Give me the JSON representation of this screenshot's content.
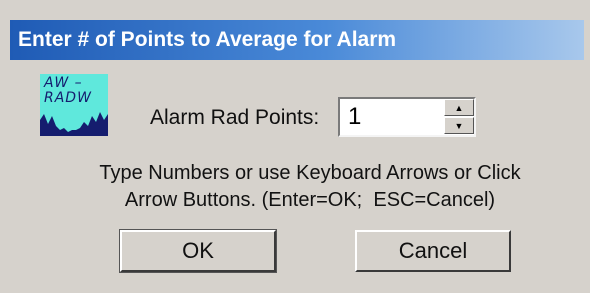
{
  "window": {
    "title": "Enter # of Points to Average for Alarm"
  },
  "app_icon": {
    "line1": "AW –",
    "line2": "RADW"
  },
  "field": {
    "label": "Alarm Rad Points:",
    "value": "1"
  },
  "help": {
    "line1": "Type Numbers or use Keyboard Arrows or Click",
    "line2": "Arrow Buttons. (Enter=OK;  ESC=Cancel)"
  },
  "buttons": {
    "ok_label": "OK",
    "cancel_label": "Cancel"
  },
  "colors": {
    "titlebar_start": "#1f5bb5",
    "titlebar_end": "#a8c8ec",
    "dialog_bg": "#d6d2cc",
    "icon_bg": "#5fe8dc"
  }
}
